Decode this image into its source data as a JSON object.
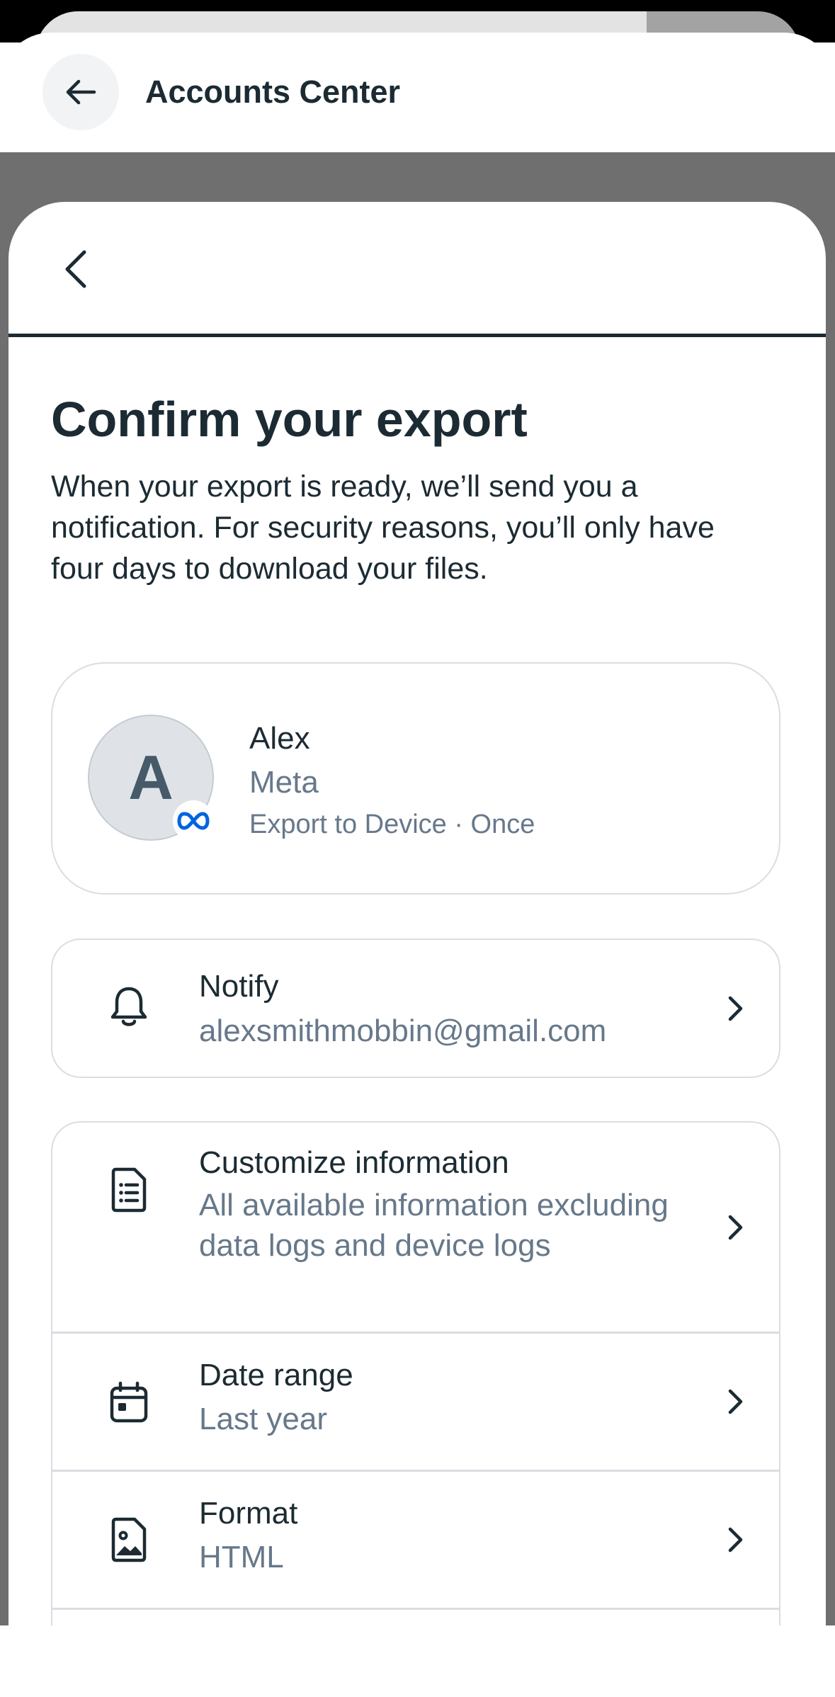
{
  "accounts_center": {
    "title": "Accounts Center"
  },
  "export": {
    "headline": "Confirm your export",
    "description": "When your export is ready, we’ll send you a notification. For security reasons, you’ll only have four days to download your files."
  },
  "account": {
    "avatar_letter": "A",
    "name": "Alex",
    "org": "Meta",
    "export_target": "Export to Device · Once"
  },
  "notify": {
    "label": "Notify",
    "value": "alexsmithmobbin@gmail.com"
  },
  "settings": [
    {
      "label": "Customize information",
      "value": "All available information excluding data logs and device logs",
      "icon": "document-list-icon"
    },
    {
      "label": "Date range",
      "value": "Last year",
      "icon": "calendar-icon"
    },
    {
      "label": "Format",
      "value": "HTML",
      "icon": "image-file-icon"
    }
  ],
  "colors": {
    "text_primary": "#1c2b33",
    "text_secondary": "#67788a",
    "meta_blue": "#0064e0",
    "border": "#dadde1"
  }
}
